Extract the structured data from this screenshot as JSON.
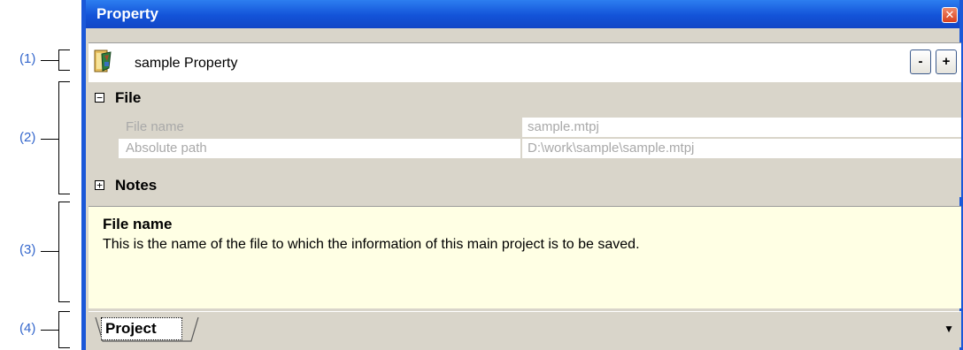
{
  "callouts": [
    "(1)",
    "(2)",
    "(3)",
    "(4)"
  ],
  "window": {
    "title": "Property",
    "close_glyph": "✕"
  },
  "header": {
    "label": "sample Property",
    "icon": "project-file-icon",
    "minus_label": "-",
    "plus_label": "+"
  },
  "grid": {
    "categories": [
      {
        "label": "File",
        "toggle": "⊟",
        "expanded": true
      },
      {
        "label": "Notes",
        "toggle": "⊞",
        "expanded": false
      }
    ],
    "properties": [
      {
        "name": "File name",
        "value": "sample.mtpj"
      },
      {
        "name": "Absolute path",
        "value": "D:\\work\\sample\\sample.mtpj"
      }
    ]
  },
  "description": {
    "title": "File name",
    "text": "This is the name of the file to which the information of this main project is to be saved."
  },
  "tabs": [
    {
      "label": "Project"
    }
  ],
  "colors": {
    "titlebar": "#1353d8",
    "callout": "#3366cc",
    "desc_bg": "#ffffe4",
    "panel_bg": "#d9d5ca"
  }
}
